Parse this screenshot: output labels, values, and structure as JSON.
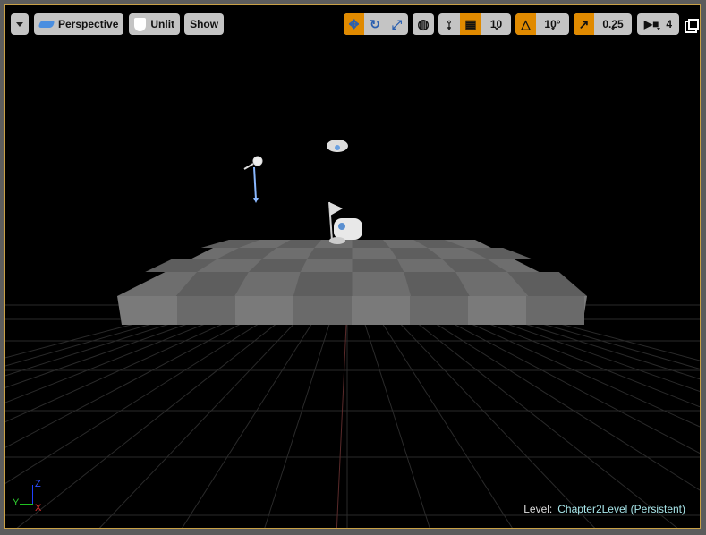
{
  "toolbar": {
    "view_mode": "Perspective",
    "lighting_mode": "Unlit",
    "show_label": "Show",
    "grid_snap_value": "10",
    "rotation_snap_value": "10°",
    "scale_snap_value": "0.25",
    "camera_speed_value": "4"
  },
  "axis": {
    "z": "Z",
    "y": "Y",
    "x": "X"
  },
  "status": {
    "level_label": "Level:",
    "level_name": "Chapter2Level (Persistent)"
  },
  "colors": {
    "accent": "#e08a00",
    "border": "#c8a046",
    "button": "#c4c4c4"
  }
}
